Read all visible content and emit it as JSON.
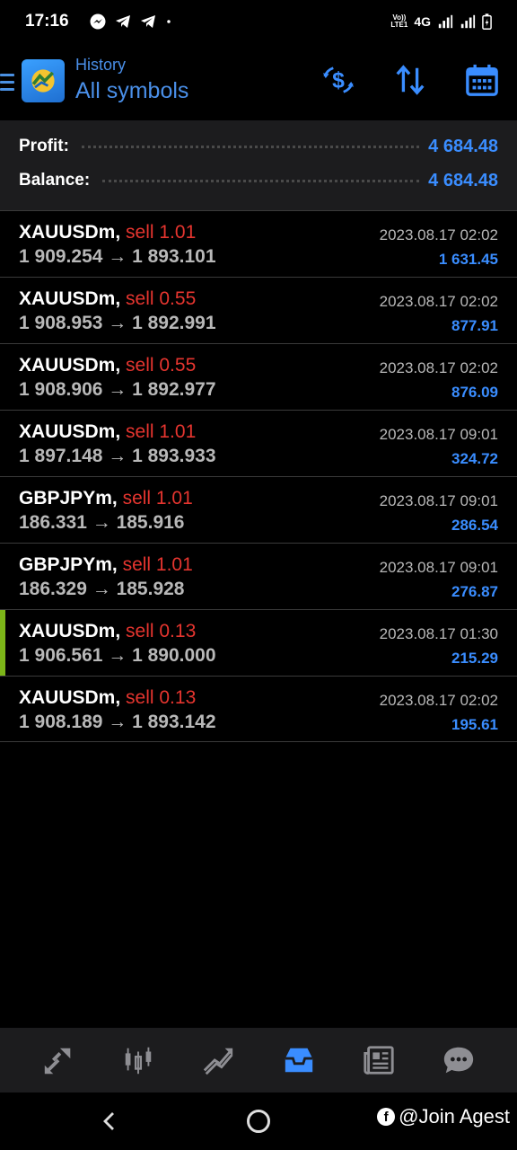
{
  "status_bar": {
    "time": "17:16",
    "volte": "Vo))\nLTE1",
    "network": "4G"
  },
  "header": {
    "subtitle": "History",
    "title": "All symbols"
  },
  "summary": {
    "profit_label": "Profit:",
    "profit_value": "4 684.48",
    "balance_label": "Balance:",
    "balance_value": "4 684.48"
  },
  "trades": [
    {
      "symbol": "XAUUSDm,",
      "side": "sell 1.01",
      "prices": "1 909.254 → 1 893.101",
      "time": "2023.08.17 02:02",
      "profit": "1 631.45"
    },
    {
      "symbol": "XAUUSDm,",
      "side": "sell 0.55",
      "prices": "1 908.953 → 1 892.991",
      "time": "2023.08.17 02:02",
      "profit": "877.91"
    },
    {
      "symbol": "XAUUSDm,",
      "side": "sell 0.55",
      "prices": "1 908.906 → 1 892.977",
      "time": "2023.08.17 02:02",
      "profit": "876.09"
    },
    {
      "symbol": "XAUUSDm,",
      "side": "sell 1.01",
      "prices": "1 897.148 → 1 893.933",
      "time": "2023.08.17 09:01",
      "profit": "324.72"
    },
    {
      "symbol": "GBPJPYm,",
      "side": "sell 1.01",
      "prices": "186.331 → 185.916",
      "time": "2023.08.17 09:01",
      "profit": "286.54"
    },
    {
      "symbol": "GBPJPYm,",
      "side": "sell 1.01",
      "prices": "186.329 → 185.928",
      "time": "2023.08.17 09:01",
      "profit": "276.87"
    },
    {
      "symbol": "XAUUSDm,",
      "side": "sell 0.13",
      "prices": "1 906.561 → 1 890.000",
      "time": "2023.08.17 01:30",
      "profit": "215.29"
    },
    {
      "symbol": "XAUUSDm,",
      "side": "sell 0.13",
      "prices": "1 908.189 → 1 893.142",
      "time": "2023.08.17 02:02",
      "profit": "195.61"
    }
  ],
  "bottom_nav": {
    "items": [
      "quotes-icon",
      "chart-icon",
      "trade-icon",
      "history-icon",
      "news-icon",
      "messages-icon"
    ],
    "active": "history-icon"
  },
  "watermark": {
    "text": "@Join Agest"
  },
  "colors": {
    "accent": "#3a8dff",
    "sell": "#e5352f",
    "active_marker": "#7cb518"
  }
}
